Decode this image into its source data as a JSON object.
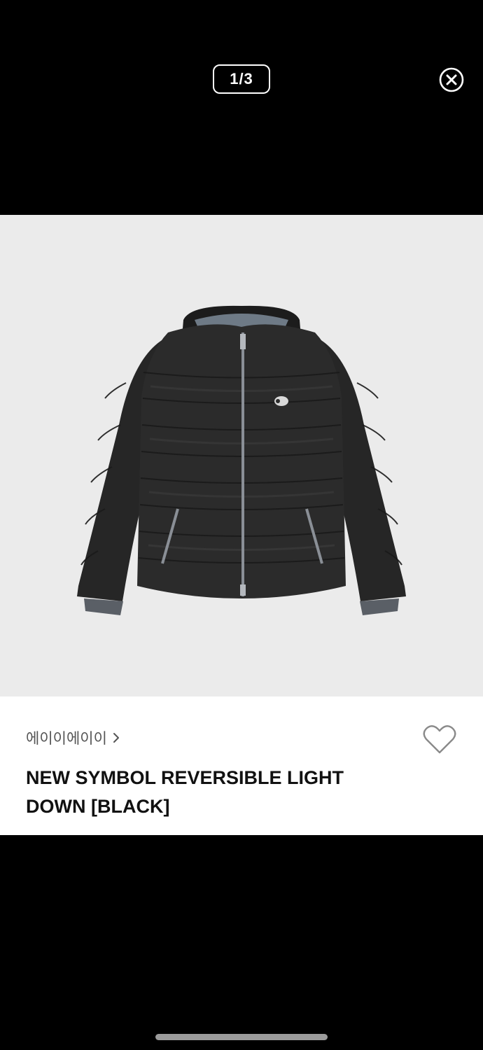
{
  "viewer": {
    "counter": "1/3",
    "close_icon": "close-circle-icon"
  },
  "product": {
    "brand": "에이이에이이",
    "brand_icon": "chevron-right-icon",
    "title": "NEW SYMBOL REVERSIBLE LIGHT DOWN [BLACK]",
    "wishlist_icon": "heart-outline-icon"
  },
  "colors": {
    "background": "#000000",
    "image_backdrop": "#ebebeb",
    "panel": "#ffffff"
  }
}
